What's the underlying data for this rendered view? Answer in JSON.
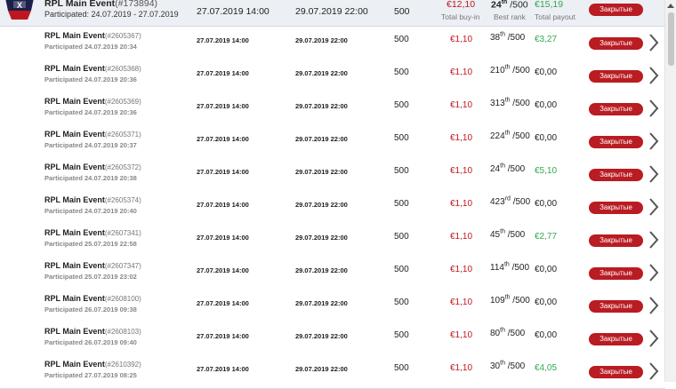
{
  "summary": {
    "name": "RPL Main Event",
    "id": "(#173894)",
    "participated": "Participated: 24.07.2019 - 27.07.2019",
    "start": "27.07.2019 14:00",
    "end": "29.07.2019 22:00",
    "players": "500",
    "buyin": "€12,10",
    "buyin_label": "Total buy-in",
    "rank": "24",
    "rank_suffix": "th",
    "rank_total": " /500",
    "rank_label": "Best rank",
    "payout": "€15,19",
    "payout_label": "Total payout",
    "status": "Закрытые"
  },
  "rows": [
    {
      "name": "RPL Main Event",
      "id": "(#2605367)",
      "participated": "Participated 24.07.2019 20:34",
      "start": "27.07.2019 14:00",
      "end": "29.07.2019 22:00",
      "players": "500",
      "buyin": "€1,10",
      "rank": "38",
      "rank_suffix": "th",
      "rank_total": " /500",
      "payout": "€3,27",
      "payout_color": "#34a853",
      "status": "Закрытые"
    },
    {
      "name": "RPL Main Event",
      "id": "(#2605368)",
      "participated": "Participated 24.07.2019 20:36",
      "start": "27.07.2019 14:00",
      "end": "29.07.2019 22:00",
      "players": "500",
      "buyin": "€1,10",
      "rank": "210",
      "rank_suffix": "th",
      "rank_total": " /500",
      "payout": "€0,00",
      "payout_color": "#222222",
      "status": "Закрытые"
    },
    {
      "name": "RPL Main Event",
      "id": "(#2605369)",
      "participated": "Participated 24.07.2019 20:36",
      "start": "27.07.2019 14:00",
      "end": "29.07.2019 22:00",
      "players": "500",
      "buyin": "€1,10",
      "rank": "313",
      "rank_suffix": "th",
      "rank_total": " /500",
      "payout": "€0,00",
      "payout_color": "#222222",
      "status": "Закрытые"
    },
    {
      "name": "RPL Main Event",
      "id": "(#2605371)",
      "participated": "Participated 24.07.2019 20:37",
      "start": "27.07.2019 14:00",
      "end": "29.07.2019 22:00",
      "players": "500",
      "buyin": "€1,10",
      "rank": "224",
      "rank_suffix": "th",
      "rank_total": " /500",
      "payout": "€0,00",
      "payout_color": "#222222",
      "status": "Закрытые"
    },
    {
      "name": "RPL Main Event",
      "id": "(#2605372)",
      "participated": "Participated 24.07.2019 20:38",
      "start": "27.07.2019 14:00",
      "end": "29.07.2019 22:00",
      "players": "500",
      "buyin": "€1,10",
      "rank": "24",
      "rank_suffix": "th",
      "rank_total": " /500",
      "payout": "€5,10",
      "payout_color": "#34a853",
      "status": "Закрытые"
    },
    {
      "name": "RPL Main Event",
      "id": "(#2605374)",
      "participated": "Participated 24.07.2019 20:40",
      "start": "27.07.2019 14:00",
      "end": "29.07.2019 22:00",
      "players": "500",
      "buyin": "€1,10",
      "rank": "423",
      "rank_suffix": "rd",
      "rank_total": " /500",
      "payout": "€0,00",
      "payout_color": "#222222",
      "status": "Закрытые"
    },
    {
      "name": "RPL Main Event",
      "id": "(#2607341)",
      "participated": "Participated 25.07.2019 22:58",
      "start": "27.07.2019 14:00",
      "end": "29.07.2019 22:00",
      "players": "500",
      "buyin": "€1,10",
      "rank": "45",
      "rank_suffix": "th",
      "rank_total": " /500",
      "payout": "€2,77",
      "payout_color": "#34a853",
      "status": "Закрытые"
    },
    {
      "name": "RPL Main Event",
      "id": "(#2607347)",
      "participated": "Participated 25.07.2019 23:02",
      "start": "27.07.2019 14:00",
      "end": "29.07.2019 22:00",
      "players": "500",
      "buyin": "€1,10",
      "rank": "114",
      "rank_suffix": "th",
      "rank_total": " /500",
      "payout": "€0,00",
      "payout_color": "#222222",
      "status": "Закрытые"
    },
    {
      "name": "RPL Main Event",
      "id": "(#2608100)",
      "participated": "Participated 26.07.2019 09:38",
      "start": "27.07.2019 14:00",
      "end": "29.07.2019 22:00",
      "players": "500",
      "buyin": "€1,10",
      "rank": "109",
      "rank_suffix": "th",
      "rank_total": " /500",
      "payout": "€0,00",
      "payout_color": "#222222",
      "status": "Закрытые"
    },
    {
      "name": "RPL Main Event",
      "id": "(#2608103)",
      "participated": "Participated 26.07.2019 09:40",
      "start": "27.07.2019 14:00",
      "end": "29.07.2019 22:00",
      "players": "500",
      "buyin": "€1,10",
      "rank": "80",
      "rank_suffix": "th",
      "rank_total": " /500",
      "payout": "€0,00",
      "payout_color": "#222222",
      "status": "Закрытые"
    },
    {
      "name": "RPL Main Event",
      "id": "(#2610392)",
      "participated": "Participated 27.07.2019 08:25",
      "start": "27.07.2019 14:00",
      "end": "29.07.2019 22:00",
      "players": "500",
      "buyin": "€1,10",
      "rank": "30",
      "rank_suffix": "th",
      "rank_total": " /500",
      "payout": "€4,05",
      "payout_color": "#34a853",
      "status": "Закрытые"
    }
  ],
  "icons": {
    "badge": "tournament-badge-icon",
    "arrow": "chevron-right-icon",
    "scroll_up": "scroll-up-arrow-icon"
  }
}
